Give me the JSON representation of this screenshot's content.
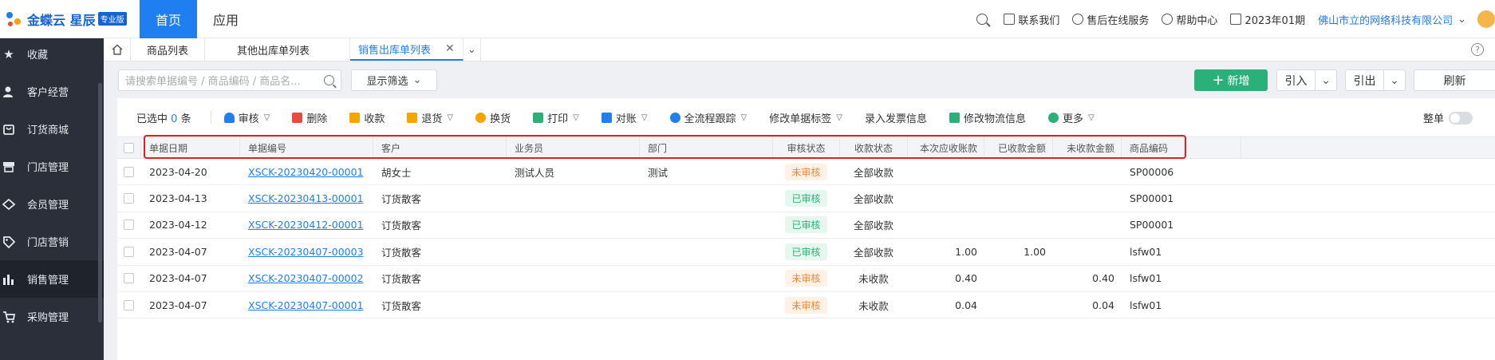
{
  "topbar": {
    "logo_text": "金蝶云 星辰",
    "logo_badge": "专业版",
    "nav_home": "首页",
    "nav_app": "应用",
    "contact": "联系我们",
    "service": "售后在线服务",
    "help": "帮助中心",
    "period": "2023年01期",
    "company": "佛山市立的网络科技有限公司"
  },
  "sidebar": {
    "items": [
      {
        "label": "收藏",
        "icon": "star-icon"
      },
      {
        "label": "客户经营",
        "icon": "user-icon"
      },
      {
        "label": "订货商城",
        "icon": "shop-icon"
      },
      {
        "label": "门店管理",
        "icon": "store-icon"
      },
      {
        "label": "会员管理",
        "icon": "diamond-icon"
      },
      {
        "label": "门店营销",
        "icon": "tag-icon"
      },
      {
        "label": "销售管理",
        "icon": "bar-chart-icon"
      },
      {
        "label": "采购管理",
        "icon": "cart-icon"
      }
    ]
  },
  "tabs": {
    "items": [
      {
        "label": "商品列表"
      },
      {
        "label": "其他出库单列表"
      },
      {
        "label": "销售出库单列表"
      }
    ],
    "help": "?"
  },
  "search": {
    "placeholder": "请搜索单据编号 / 商品编码 / 商品名...",
    "filter_label": "显示筛选",
    "new_label": "新增",
    "import_label": "引入",
    "export_label": "引出",
    "refresh_label": "刷新"
  },
  "toolbar": {
    "selected_prefix": "已选中",
    "selected_count": "0",
    "selected_suffix": "条",
    "audit": "审核",
    "delete": "删除",
    "collect": "收款",
    "return": "退货",
    "exchange": "换货",
    "print": "打印",
    "reconcile": "对账",
    "trace": "全流程跟踪",
    "modify_tags": "修改单据标签",
    "invoice": "录入发票信息",
    "logistics": "修改物流信息",
    "more": "更多",
    "whole": "整单"
  },
  "table": {
    "headers": [
      "单据日期",
      "单据编号",
      "客户",
      "业务员",
      "部门",
      "审核状态",
      "收款状态",
      "本次应收账款",
      "已收款金额",
      "未收款金额",
      "商品编码"
    ],
    "rows": [
      {
        "date": "2023-04-20",
        "no": "XSCK-20230420-00001",
        "customer": "胡女士",
        "sales": "测试人员",
        "dept": "测试",
        "audit": "未审核",
        "audit_type": "pending",
        "pay": "全部收款",
        "due": "",
        "recv": "",
        "unrecv": "",
        "goods": "SP00006"
      },
      {
        "date": "2023-04-13",
        "no": "XSCK-20230413-00001",
        "customer": "订货散客",
        "sales": "",
        "dept": "",
        "audit": "已审核",
        "audit_type": "done",
        "pay": "全部收款",
        "due": "",
        "recv": "",
        "unrecv": "",
        "goods": "SP00001"
      },
      {
        "date": "2023-04-12",
        "no": "XSCK-20230412-00001",
        "customer": "订货散客",
        "sales": "",
        "dept": "",
        "audit": "已审核",
        "audit_type": "done",
        "pay": "全部收款",
        "due": "",
        "recv": "",
        "unrecv": "",
        "goods": "SP00001"
      },
      {
        "date": "2023-04-07",
        "no": "XSCK-20230407-00003",
        "customer": "订货散客",
        "sales": "",
        "dept": "",
        "audit": "已审核",
        "audit_type": "done",
        "pay": "全部收款",
        "due": "1.00",
        "recv": "1.00",
        "unrecv": "",
        "goods": "lsfw01"
      },
      {
        "date": "2023-04-07",
        "no": "XSCK-20230407-00002",
        "customer": "订货散客",
        "sales": "",
        "dept": "",
        "audit": "未审核",
        "audit_type": "pending",
        "pay": "未收款",
        "due": "0.40",
        "recv": "",
        "unrecv": "0.40",
        "goods": "lsfw01"
      },
      {
        "date": "2023-04-07",
        "no": "XSCK-20230407-00001",
        "customer": "订货散客",
        "sales": "",
        "dept": "",
        "audit": "未审核",
        "audit_type": "pending",
        "pay": "未收款",
        "due": "0.04",
        "recv": "",
        "unrecv": "0.04",
        "goods": "lsfw01"
      }
    ]
  },
  "colors": {
    "primary": "#1f7ef0",
    "success": "#2bb07a",
    "warning": "#f0883a",
    "highlight": "#e32020",
    "sidebar": "#2a2f3a"
  }
}
